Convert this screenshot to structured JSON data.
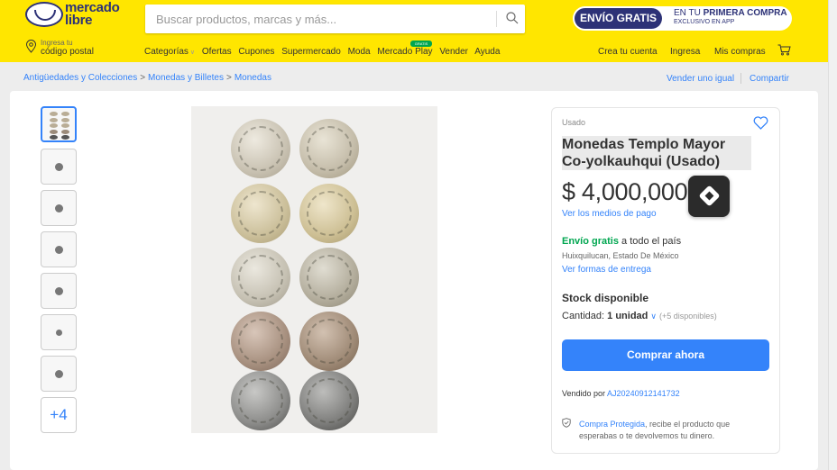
{
  "header": {
    "logo_line1": "mercado",
    "logo_line2": "libre",
    "search_placeholder": "Buscar productos, marcas y más...",
    "promo_left": "ENVÍO GRATIS",
    "promo_right_line1_prefix": "EN TU ",
    "promo_right_line1_bold": "PRIMERA COMPRA",
    "promo_right_line2": "EXCLUSIVO EN APP",
    "location_line1": "Ingresa tu",
    "location_line2": "código postal",
    "nav": [
      "Categorías",
      "Ofertas",
      "Cupones",
      "Supermercado",
      "Moda",
      "Mercado Play",
      "Vender",
      "Ayuda"
    ],
    "gratis_badge": "GRATIS",
    "right_nav": [
      "Crea tu cuenta",
      "Ingresa",
      "Mis compras"
    ],
    "accent": "#ffe600",
    "brand_blue": "#2d3277"
  },
  "breadcrumb": {
    "items": [
      "Antigüedades y Colecciones",
      "Monedas y Billetes",
      "Monedas"
    ],
    "sell_similar": "Vender uno igual",
    "share": "Compartir"
  },
  "gallery": {
    "more_label": "+4"
  },
  "product": {
    "condition": "Usado",
    "title": "Monedas Templo Mayor Co-yolkauhqui (Usado)",
    "price": "$ 4,000,000",
    "payment_link": "Ver los medios de pago",
    "shipping_free": "Envío gratis",
    "shipping_rest": " a todo el país",
    "shipping_location": "Huixquilucan, Estado De México",
    "shipping_link": "Ver formas de entrega",
    "stock": "Stock disponible",
    "qty_label": "Cantidad: ",
    "qty_value": "1 unidad",
    "qty_available": "(+5 disponibles)",
    "buy_button": "Comprar ahora",
    "seller_prefix": "Vendido por ",
    "seller_name": "AJ20240912141732",
    "protect_link": "Compra Protegida",
    "protect_text": ", recibe el producto que esperabas o te devolvemos tu dinero.",
    "primary_color": "#3483fa",
    "success_color": "#00a650"
  }
}
